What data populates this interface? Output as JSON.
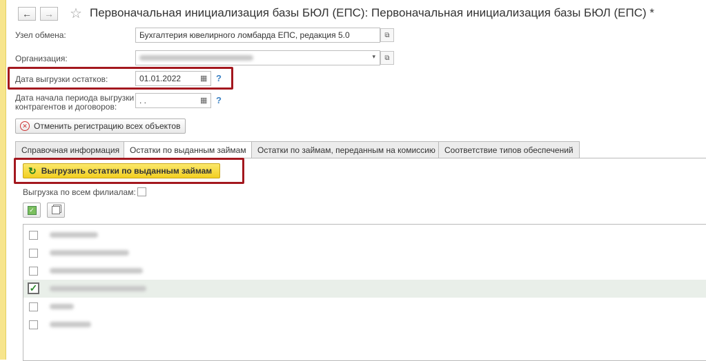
{
  "window": {
    "title": "Первоначальная инициализация базы БЮЛ (ЕПС): Первоначальная инициализация базы БЮЛ (ЕПС) *"
  },
  "nav": {
    "back_icon": "arrow-left-icon",
    "forward_icon": "arrow-right-icon",
    "favorite_icon": "star-icon"
  },
  "form": {
    "exchange_node_label": "Узел обмена:",
    "exchange_node_value": "Бухгалтерия ювелирного ломбарда ЕПС, редакция 5.0",
    "organization_label": "Организация:",
    "organization_value": "",
    "unload_date_label": "Дата выгрузки остатков:",
    "unload_date_value": "01.01.2022",
    "period_start_label_line1": "Дата начала периода выгрузки",
    "period_start_label_line2": "контрагентов и договоров:",
    "period_start_value": " .  .",
    "help_mark": "?",
    "cancel_button_label": "Отменить регистрацию всех объектов"
  },
  "tabs": [
    {
      "label": "Справочная информация",
      "active": false
    },
    {
      "label": "Остатки по выданным займам",
      "active": true
    },
    {
      "label": "Остатки по займам, переданным на комиссию",
      "active": false
    },
    {
      "label": "Соответствие типов обеспечений",
      "active": false
    }
  ],
  "tab_content": {
    "unload_button_label": "Выгрузить остатки по выданным займам",
    "all_branches_label": "Выгрузка по всем филиалам:",
    "all_branches_checked": false
  },
  "branches": [
    {
      "label": "",
      "checked": false,
      "selected": false
    },
    {
      "label": "",
      "checked": false,
      "selected": false
    },
    {
      "label": "",
      "checked": false,
      "selected": false
    },
    {
      "label": "",
      "checked": true,
      "selected": true
    },
    {
      "label": "",
      "checked": false,
      "selected": false
    },
    {
      "label": "",
      "checked": false,
      "selected": false
    }
  ],
  "colors": {
    "accent_yellow": "#f2cf21",
    "highlight_red": "#a3171e",
    "left_panel": "#f7e58c",
    "check_green": "#2e8b2e"
  }
}
